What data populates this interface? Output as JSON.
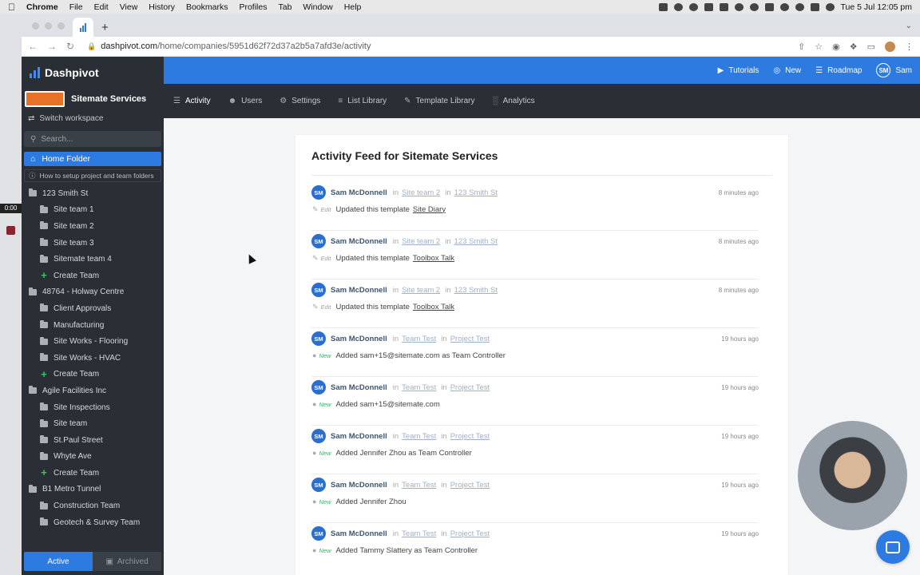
{
  "menubar": {
    "app": "Chrome",
    "items": [
      "File",
      "Edit",
      "View",
      "History",
      "Bookmarks",
      "Profiles",
      "Tab",
      "Window",
      "Help"
    ],
    "clock": "Tue 5 Jul  12:05 pm"
  },
  "browser": {
    "url_host": "dashpivot.com",
    "url_path": "/home/companies/5951d62f72d37a2b5a7afd3e/activity"
  },
  "sidebar": {
    "brand": "Dashpivot",
    "workspace_name": "Sitemate Services",
    "switch_label": "Switch workspace",
    "search_placeholder": "Search...",
    "home_label": "Home Folder",
    "help_label": "How to setup project and team folders",
    "tree": [
      {
        "label": "123 Smith St",
        "level": 0,
        "type": "folder"
      },
      {
        "label": "Site team 1",
        "level": 1,
        "type": "folder"
      },
      {
        "label": "Site team 2",
        "level": 1,
        "type": "folder"
      },
      {
        "label": "Site team 3",
        "level": 1,
        "type": "folder"
      },
      {
        "label": "Sitemate team 4",
        "level": 1,
        "type": "folder"
      },
      {
        "label": "Create Team",
        "level": 1,
        "type": "create"
      },
      {
        "label": "48764 - Holway Centre",
        "level": 0,
        "type": "folder"
      },
      {
        "label": "Client Approvals",
        "level": 1,
        "type": "folder"
      },
      {
        "label": "Manufacturing",
        "level": 1,
        "type": "folder"
      },
      {
        "label": "Site Works - Flooring",
        "level": 1,
        "type": "folder"
      },
      {
        "label": "Site Works - HVAC",
        "level": 1,
        "type": "folder"
      },
      {
        "label": "Create Team",
        "level": 1,
        "type": "create"
      },
      {
        "label": "Agile Facilities Inc",
        "level": 0,
        "type": "folder"
      },
      {
        "label": "Site Inspections",
        "level": 1,
        "type": "folder"
      },
      {
        "label": "Site team",
        "level": 1,
        "type": "folder"
      },
      {
        "label": "St.Paul Street",
        "level": 1,
        "type": "folder"
      },
      {
        "label": "Whyte Ave",
        "level": 1,
        "type": "folder"
      },
      {
        "label": "Create Team",
        "level": 1,
        "type": "create"
      },
      {
        "label": "B1 Metro Tunnel",
        "level": 0,
        "type": "folder"
      },
      {
        "label": "Construction Team",
        "level": 1,
        "type": "folder"
      },
      {
        "label": "Geotech & Survey Team",
        "level": 1,
        "type": "folder"
      }
    ],
    "active_label": "Active",
    "archived_label": "Archived"
  },
  "topbar": {
    "tutorials": "Tutorials",
    "new": "New",
    "roadmap": "Roadmap",
    "user_initials": "SM",
    "user_name": "Sam"
  },
  "subnav": {
    "activity": "Activity",
    "users": "Users",
    "settings": "Settings",
    "list_library": "List Library",
    "template_library": "Template Library",
    "analytics": "Analytics"
  },
  "feed": {
    "title": "Activity Feed for Sitemate Services",
    "entries": [
      {
        "initials": "SM",
        "user": "Sam McDonnell",
        "team": "Site team 2",
        "project": "123 Smith St",
        "time": "8 minutes ago",
        "kind": "Edit",
        "action": "Updated this template",
        "template": "Site Diary"
      },
      {
        "initials": "SM",
        "user": "Sam McDonnell",
        "team": "Site team 2",
        "project": "123 Smith St",
        "time": "8 minutes ago",
        "kind": "Edit",
        "action": "Updated this template",
        "template": "Toolbox Talk"
      },
      {
        "initials": "SM",
        "user": "Sam McDonnell",
        "team": "Site team 2",
        "project": "123 Smith St",
        "time": "8 minutes ago",
        "kind": "Edit",
        "action": "Updated this template",
        "template": "Toolbox Talk"
      },
      {
        "initials": "SM",
        "user": "Sam McDonnell",
        "team": "Team Test",
        "project": "Project Test",
        "time": "19 hours ago",
        "kind": "New",
        "action": "Added sam+15@sitemate.com as Team Controller",
        "template": ""
      },
      {
        "initials": "SM",
        "user": "Sam McDonnell",
        "team": "Team Test",
        "project": "Project Test",
        "time": "19 hours ago",
        "kind": "New",
        "action": "Added sam+15@sitemate.com",
        "template": ""
      },
      {
        "initials": "SM",
        "user": "Sam McDonnell",
        "team": "Team Test",
        "project": "Project Test",
        "time": "19 hours ago",
        "kind": "New",
        "action": "Added Jennifer Zhou as Team Controller",
        "template": ""
      },
      {
        "initials": "SM",
        "user": "Sam McDonnell",
        "team": "Team Test",
        "project": "Project Test",
        "time": "19 hours ago",
        "kind": "New",
        "action": "Added Jennifer Zhou",
        "template": ""
      },
      {
        "initials": "SM",
        "user": "Sam McDonnell",
        "team": "Team Test",
        "project": "Project Test",
        "time": "19 hours ago",
        "kind": "New",
        "action": "Added Tammy Slattery as Team Controller",
        "template": ""
      }
    ],
    "in_word": "in"
  },
  "overlay": {
    "recording_time": "0:00"
  },
  "colors": {
    "brand_blue": "#2d7be0",
    "sidebar_bg": "#2a2f35",
    "new_green": "#34b36b"
  }
}
